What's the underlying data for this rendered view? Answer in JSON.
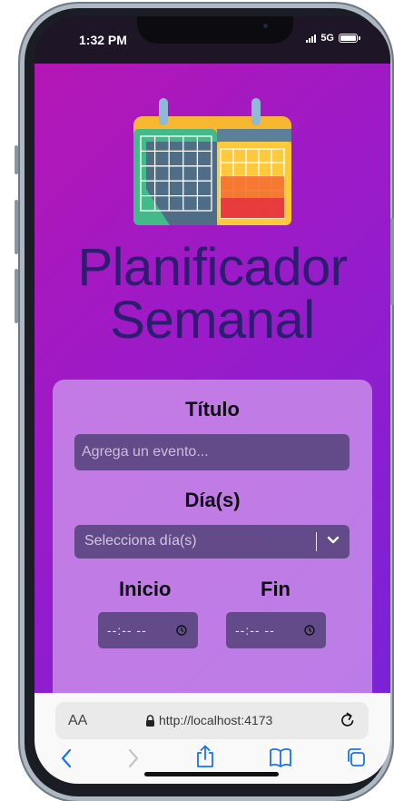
{
  "status_bar": {
    "time": "1:32 PM",
    "network": "5G",
    "icons": [
      "signal-bars-icon",
      "battery-icon"
    ]
  },
  "app": {
    "title": "Planificador Semanal",
    "title_color": "#2c1e6e",
    "background_gradient": [
      "#b416b4",
      "#7a22d6"
    ],
    "logo": "calendar-icon"
  },
  "form": {
    "title_label": "Título",
    "title_input": {
      "value": "",
      "placeholder": "Agrega un evento..."
    },
    "days_label": "Día(s)",
    "days_select": {
      "placeholder": "Selecciona día(s)",
      "icon": "chevron-down-icon"
    },
    "start_label": "Inicio",
    "end_label": "Fin",
    "start_time": {
      "placeholder": "--:-- --",
      "icon": "clock-icon"
    },
    "end_time": {
      "placeholder": "--:-- --",
      "icon": "clock-icon"
    },
    "input_color": "#624b88"
  },
  "browser": {
    "text_size_label": "AA",
    "url": "http://localhost:4173",
    "icons": [
      "lock-icon",
      "reload-icon",
      "back-icon",
      "forward-icon",
      "share-icon",
      "bookmarks-icon",
      "tabs-icon"
    ],
    "accent": "#1a73e8"
  }
}
